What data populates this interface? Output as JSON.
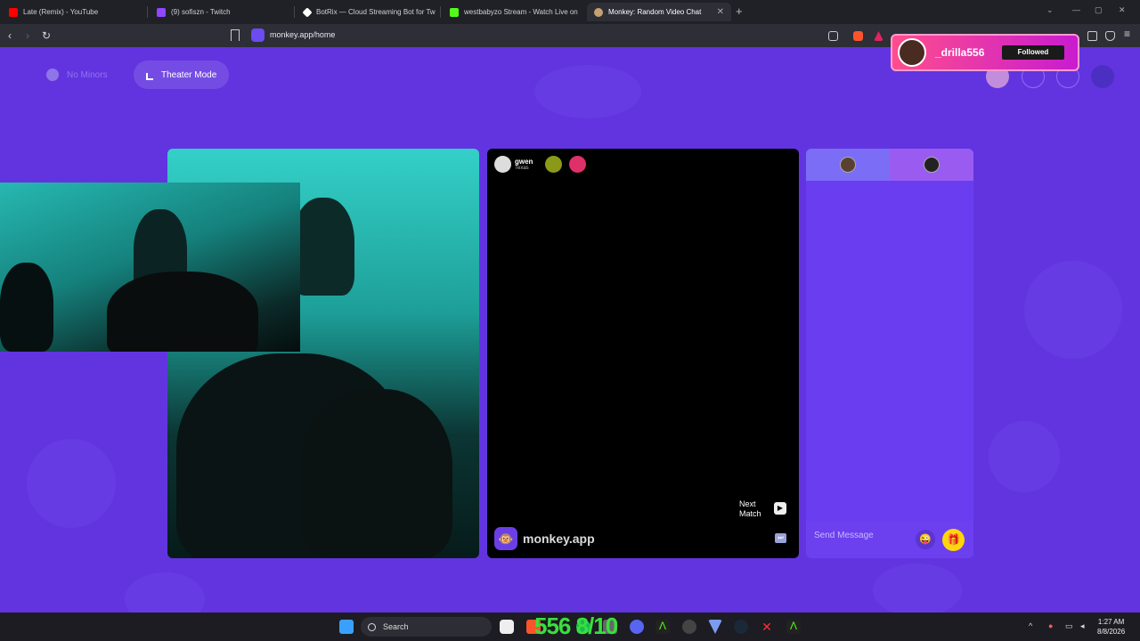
{
  "browser": {
    "tabs": [
      {
        "title": "Late (Remix) - YouTube",
        "color": "#ff0000"
      },
      {
        "title": "(9) sofiszn - Twitch",
        "color": "#9146ff"
      },
      {
        "title": "BotRix — Cloud Streaming Bot for Tw",
        "color": "#ffffff"
      },
      {
        "title": "westbabyzo Stream - Watch Live on",
        "color": "#53fc18"
      },
      {
        "title": "Monkey: Random Video Chat",
        "color": "#c8a070"
      }
    ],
    "new_tab": "+",
    "tab_close": "✕",
    "url": "monkey.app/home",
    "nav": {
      "back": "‹",
      "forward": "›",
      "reload": "↻"
    }
  },
  "toolbar": {
    "no_minors": "No Minors",
    "theater_mode": "Theater Mode"
  },
  "notification": {
    "username": "_drilla556",
    "button": "Followed"
  },
  "match": {
    "username": "gwen",
    "location": "Texas",
    "next_label_1": "Next",
    "next_label_2": "Match",
    "next_icon": "▶",
    "skip_icon": "⏭"
  },
  "brand": {
    "logo_icon": "🐵",
    "name": "monkey.app"
  },
  "chat": {
    "placeholder": "Send Message",
    "emoji_icon": "😜",
    "gift_icon": "🎁"
  },
  "taskbar": {
    "search": "Search",
    "overlay_counter": "556 8/10",
    "time": "1:27 AM",
    "date": "8/8/2026"
  },
  "colors": {
    "page_bg": "#6234e0",
    "accent": "#6b3fe8",
    "follow_gradient": "#ff4d8d"
  }
}
